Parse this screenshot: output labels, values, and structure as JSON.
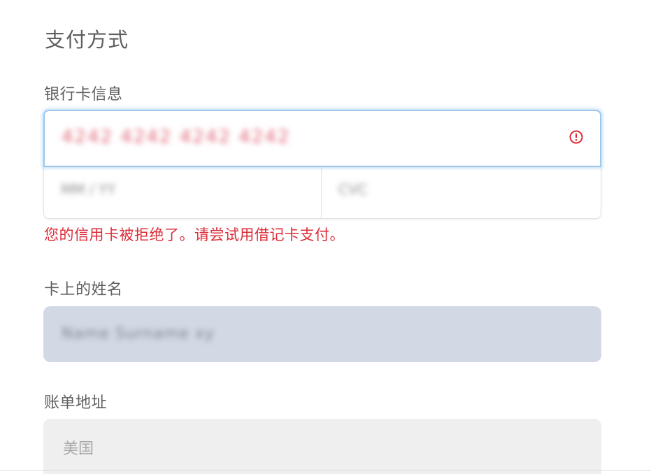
{
  "payment": {
    "section_title": "支付方式",
    "card_info_label": "银行卡信息",
    "card_number_value": "4242 4242 4242 4242",
    "card_expiry_value": "MM / YY",
    "card_cvc_value": "CVC",
    "error_message": "您的信用卡被拒绝了。请尝试用借记卡支付。",
    "name_label": "卡上的姓名",
    "name_value": "Name Surname xy",
    "billing_label": "账单地址",
    "country_value": "美国"
  },
  "icons": {
    "card_error": "exclamation-circle-icon"
  },
  "colors": {
    "error": "#dc2c38",
    "focus_border": "#9dc8ec",
    "name_field_bg": "#d3d9e4",
    "select_bg": "#efefef"
  }
}
